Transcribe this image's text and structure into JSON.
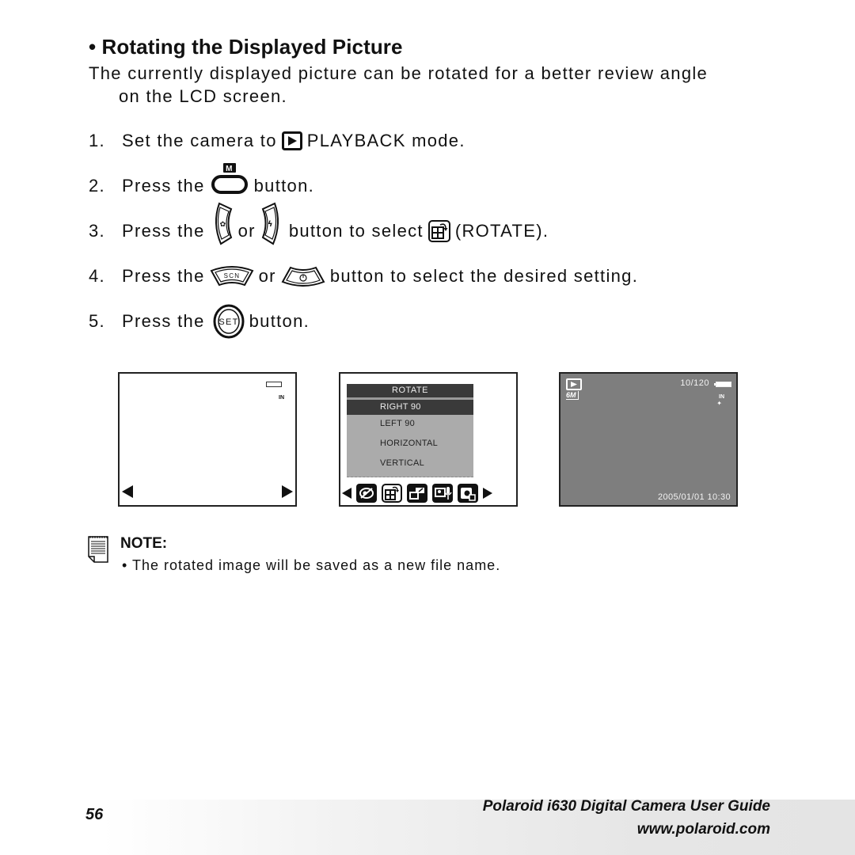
{
  "section": {
    "title": "• Rotating the Displayed Picture",
    "intro_line1": "The currently displayed picture can be rotated for a better review angle",
    "intro_line2": "on the LCD screen."
  },
  "steps": [
    {
      "num": "1.",
      "pre": "Set the camera to",
      "icon": "playback-icon",
      "post": "PLAYBACK mode."
    },
    {
      "num": "2.",
      "pre": "Press the",
      "icon": "menu-button-icon",
      "icon_label": "M",
      "post": "button."
    },
    {
      "num": "3.",
      "pre": "Press the",
      "icon": "left-macro-button-icon",
      "mid": "or",
      "icon2": "right-flash-button-icon",
      "post": "button to select",
      "icon3": "rotate-icon",
      "post2": "(ROTATE)."
    },
    {
      "num": "4.",
      "pre": "Press the",
      "icon": "scn-up-button-icon",
      "icon_label": "SCN",
      "mid": "or",
      "icon2": "self-timer-down-button-icon",
      "post": "button to select the desired setting."
    },
    {
      "num": "5.",
      "pre": "Press the",
      "icon": "set-button-icon",
      "icon_label": "SET",
      "post": "button."
    }
  ],
  "screens": {
    "screen1": {
      "storage": "IN"
    },
    "screen2": {
      "menu_title": "ROTATE",
      "options": [
        "RIGHT 90",
        "LEFT 90",
        "HORIZONTAL",
        "VERTICAL"
      ],
      "selected": "RIGHT 90",
      "tray_icons": [
        "red-eye-icon",
        "rotate-icon",
        "resize-icon",
        "voice-memo-icon",
        "protect-icon"
      ]
    },
    "screen3": {
      "counter": "10/120",
      "resolution": "6M",
      "storage": "IN",
      "datetime": "2005/01/01 10:30"
    }
  },
  "note": {
    "title": "NOTE:",
    "text": "• The rotated image will be saved as a new file name."
  },
  "footer": {
    "page_number": "56",
    "guide_title": "Polaroid i630 Digital Camera User Guide",
    "url": "www.polaroid.com"
  }
}
